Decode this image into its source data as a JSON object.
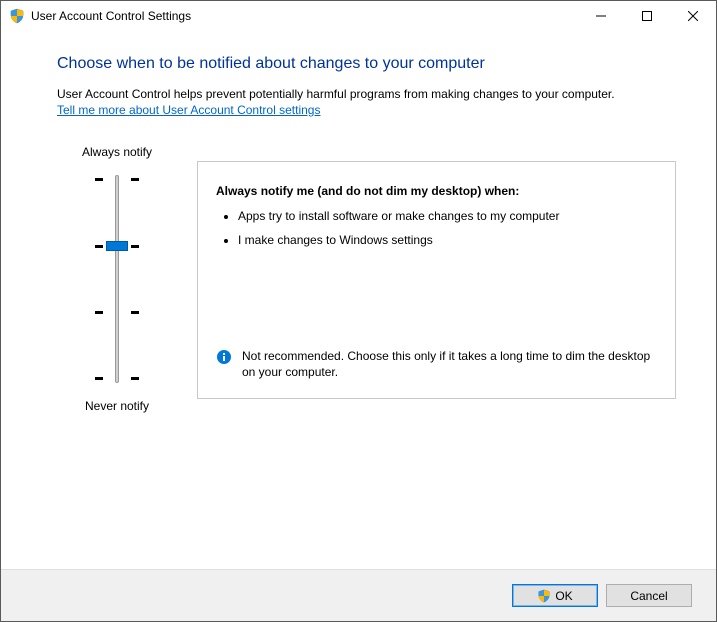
{
  "window": {
    "title": "User Account Control Settings"
  },
  "content": {
    "heading": "Choose when to be notified about changes to your computer",
    "description": "User Account Control helps prevent potentially harmful programs from making changes to your computer.",
    "link": "Tell me more about User Account Control settings"
  },
  "slider": {
    "label_top": "Always notify",
    "label_bottom": "Never notify",
    "levels": 4,
    "selected_level_index": 1
  },
  "level_description": {
    "title": "Always notify me (and do not dim my desktop) when:",
    "bullets": [
      "Apps try to install software or make changes to my computer",
      "I make changes to Windows settings"
    ],
    "note": "Not recommended. Choose this only if it takes a long time to dim the desktop on your computer."
  },
  "footer": {
    "ok_label": "OK",
    "cancel_label": "Cancel"
  }
}
